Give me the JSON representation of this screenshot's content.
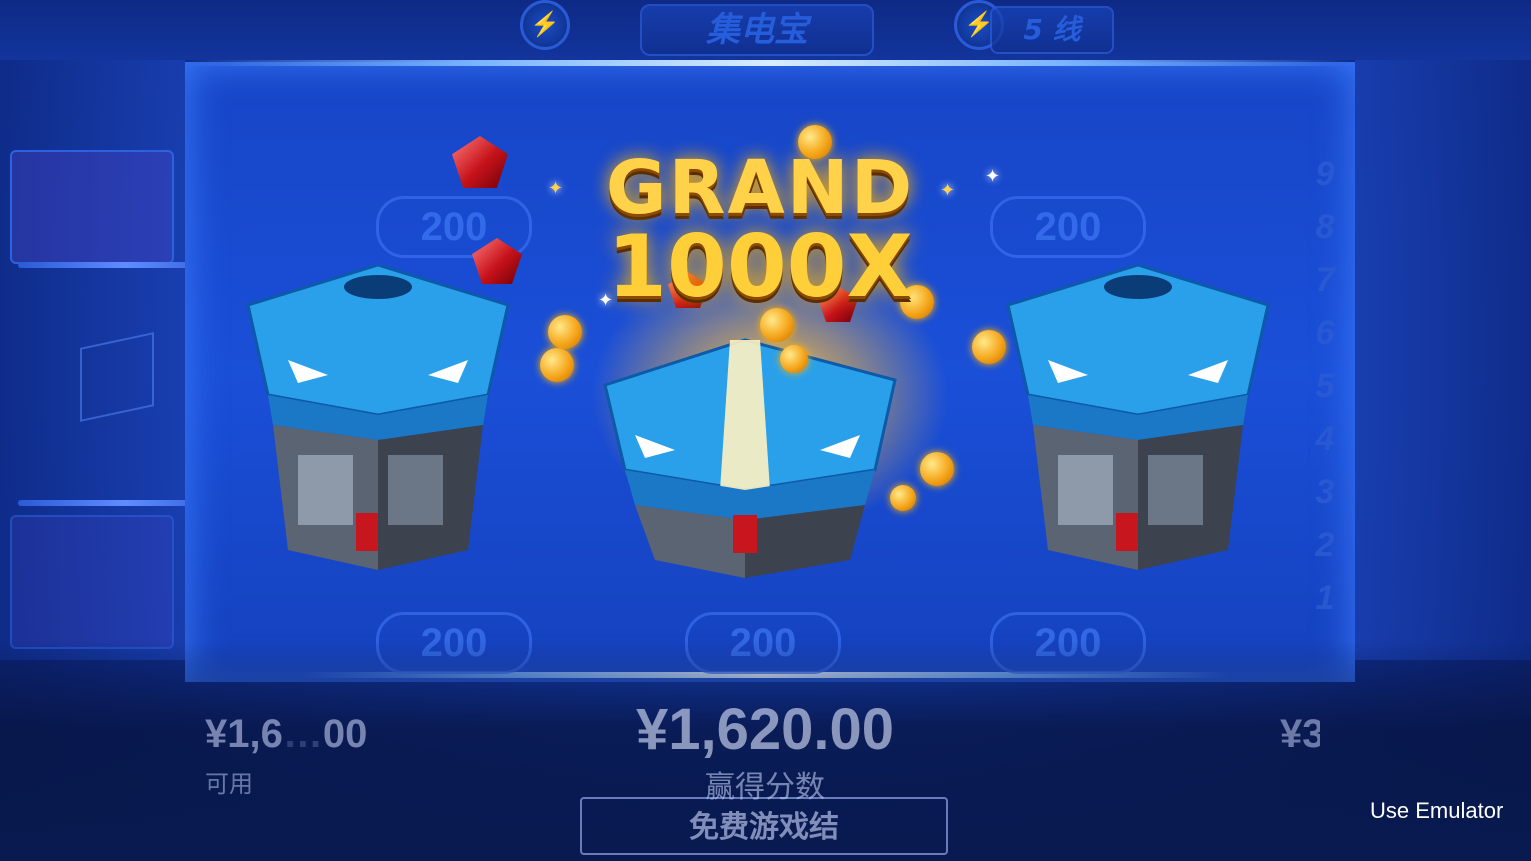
{
  "header": {
    "game_title": "集电宝",
    "lines_label": "5 线",
    "bolt_icon": "⚡"
  },
  "reels": {
    "bet_labels": [
      "200",
      "200",
      "200",
      "200",
      "200"
    ]
  },
  "line_numbers": [
    "9",
    "8",
    "7",
    "6",
    "5",
    "4",
    "3",
    "2",
    "1"
  ],
  "overlay": {
    "grand_word": "GRAND",
    "multiplier": "1000X"
  },
  "footer": {
    "balance_amount": "¥1,6",
    "balance_amount_tail": "00",
    "balance_label": "可用",
    "win_amount": "¥1,620.00",
    "win_label": "赢得分数",
    "end_button_label": "免费游戏结",
    "right_amount": "¥3"
  },
  "emulator_label": "Use Emulator",
  "colors": {
    "background": "#123aa8",
    "gold": "#ffd24a",
    "chest_blue": "#2aa0ea"
  }
}
